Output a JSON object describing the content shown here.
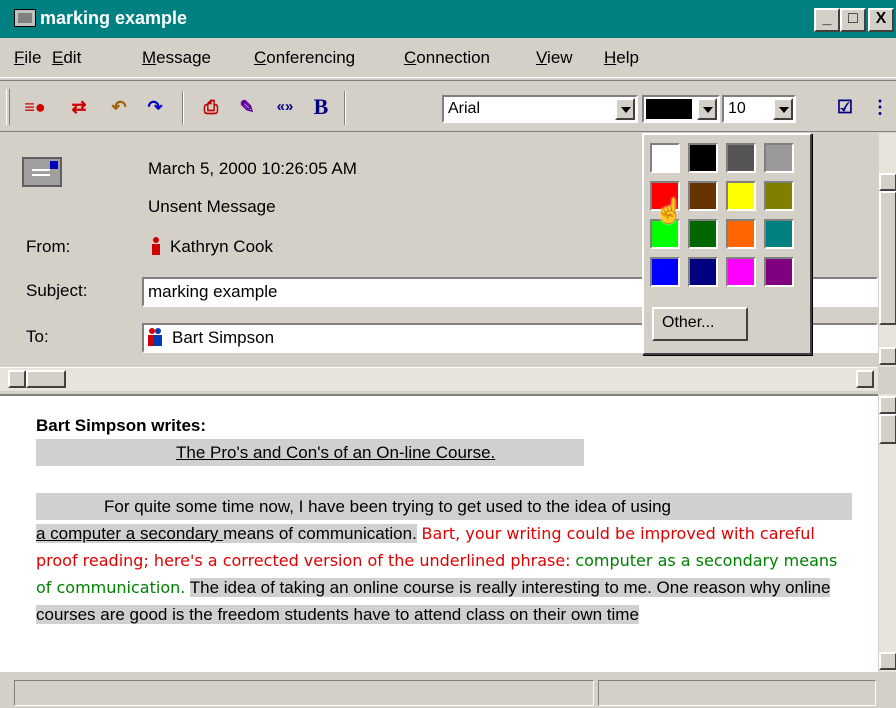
{
  "window": {
    "title": "marking example",
    "min_glyph": "_",
    "max_glyph": "□",
    "close_glyph": "X"
  },
  "menu": [
    "File",
    "Edit",
    "Message",
    "Conferencing",
    "Connection",
    "View",
    "Help"
  ],
  "toolbar": {
    "font": "Arial",
    "size": "10",
    "bold_label": "B",
    "quote_label": "«»",
    "icons": [
      "send-icon",
      "send-receive-icon",
      "reply-icon",
      "forward-icon",
      "print-icon",
      "attach-icon",
      "quote-icon",
      "bold-icon",
      "spellcheck-icon",
      "more-icon"
    ]
  },
  "header": {
    "date": "March 5, 2000 10:26:05 AM",
    "status": "Unsent Message",
    "from_label": "From:",
    "from_value": "Kathryn Cook",
    "subject_label": "Subject:",
    "subject_value": "marking example",
    "to_label": "To:",
    "to_value": "Bart Simpson"
  },
  "color_picker": {
    "selected": "#000000",
    "colors": [
      "#ffffff",
      "#000000",
      "#555555",
      "#999999",
      "#ff0000",
      "#663300",
      "#ffff00",
      "#808000",
      "#00ff00",
      "#006600",
      "#ff6600",
      "#008080",
      "#0000ff",
      "#000080",
      "#ff00ff",
      "#800080"
    ],
    "other_label": "Other..."
  },
  "body": {
    "writes": "Bart Simpson writes:",
    "heading": "The Pro's and Con's of an On-line Course.",
    "p1": "For quite some time now, I have been trying to get used to the idea of using",
    "p1b_underlined": "a computer a secondary ",
    "p1b_rest": "means of communication.",
    "comment_red": "Bart, your writing could be improved with careful proof reading; here's a corrected version of the underlined phrase:",
    "comment_green": "computer as a secondary means of communication.",
    "p2": "The idea of taking an online course is really interesting to me.  One reason why online courses are good is the freedom students have to attend class on their own time"
  }
}
